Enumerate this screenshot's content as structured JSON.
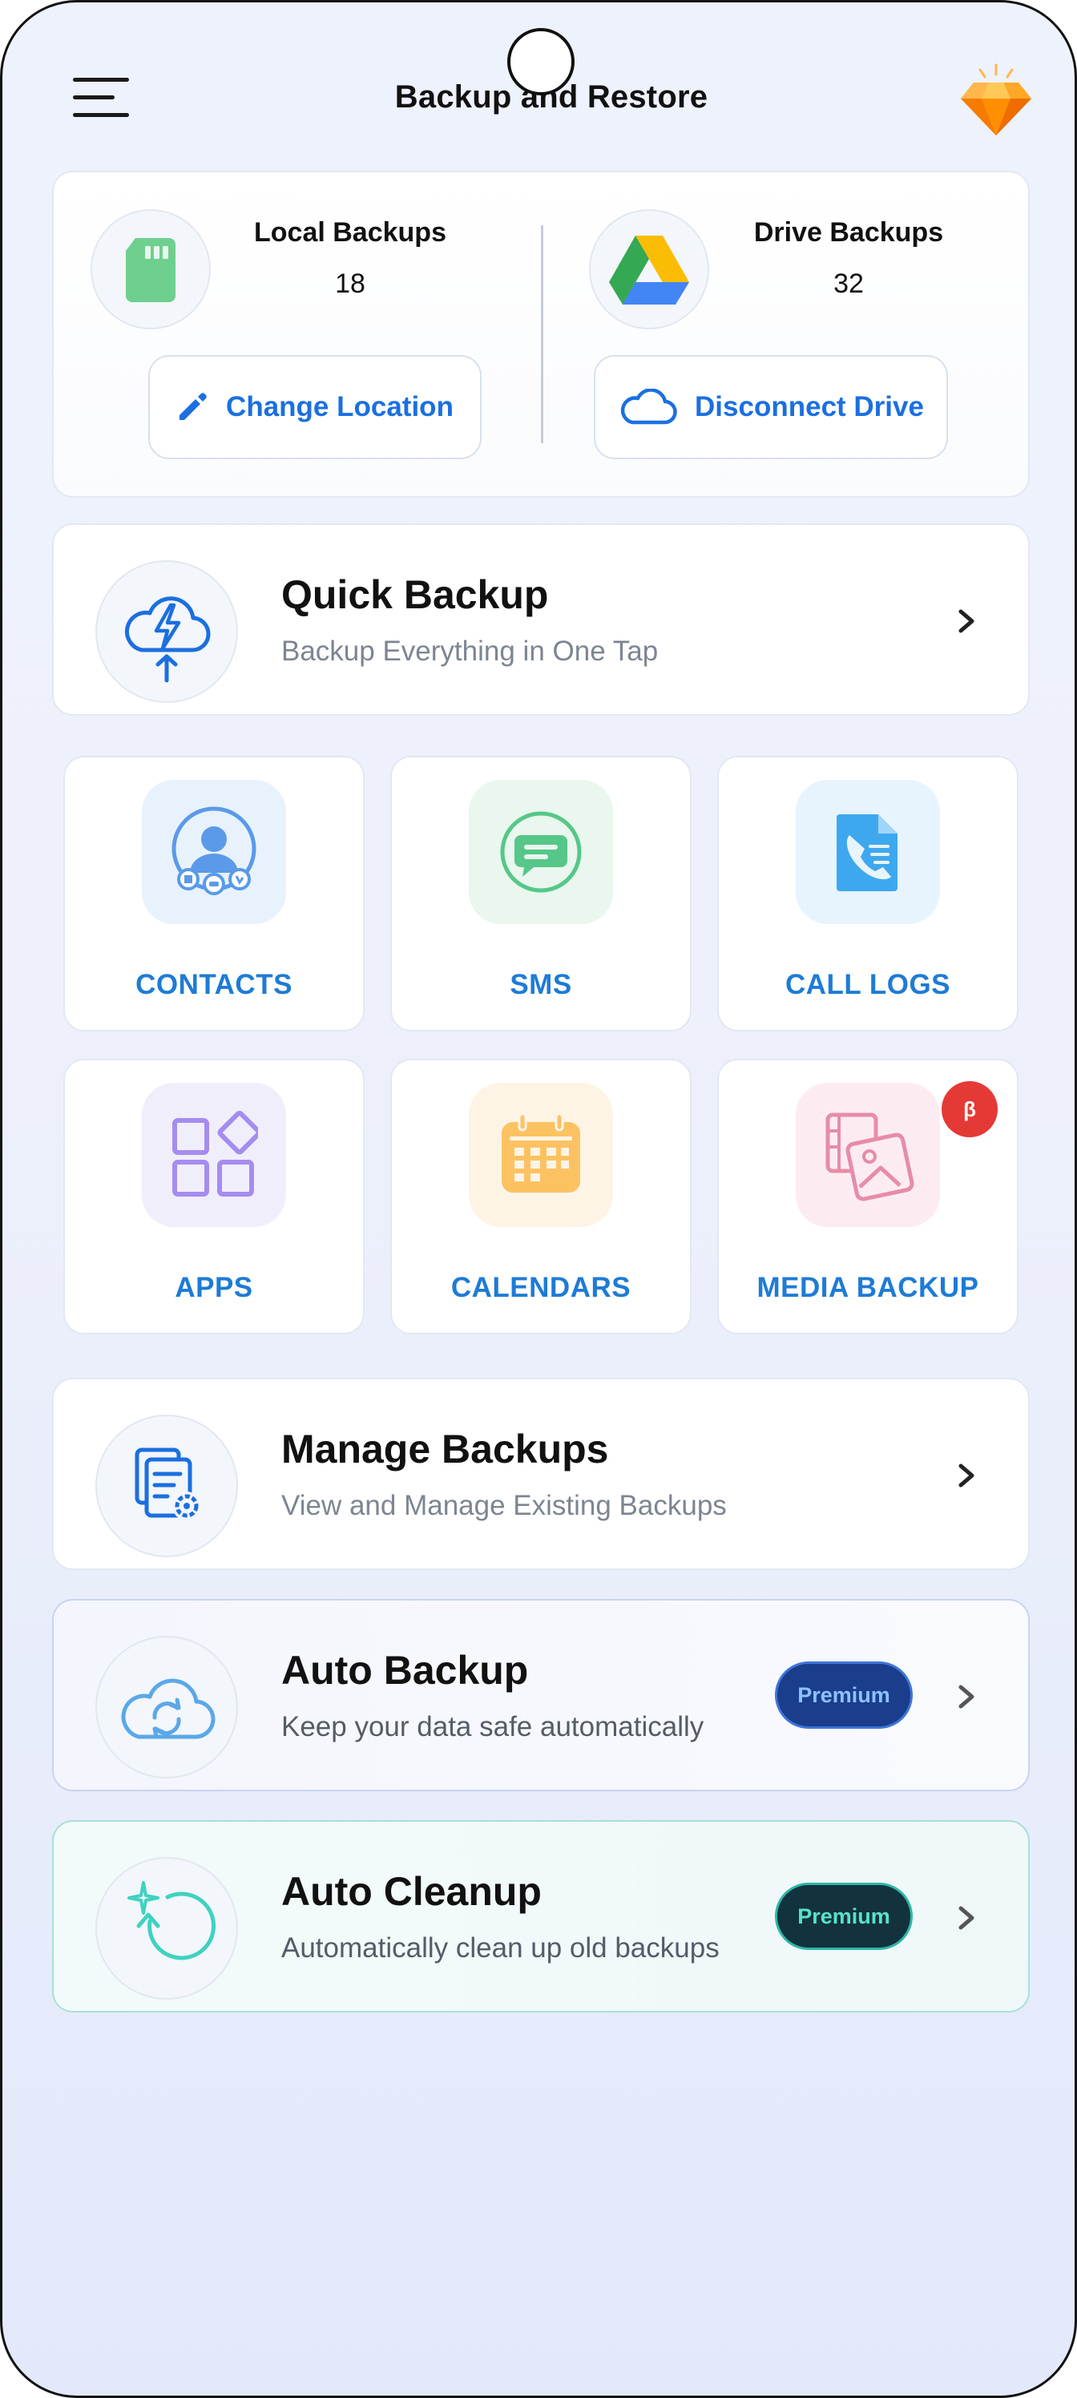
{
  "header": {
    "title": "Backup and Restore",
    "menu_icon": "hamburger-menu-icon",
    "premium_icon": "diamond-gem-icon"
  },
  "summary": {
    "local": {
      "label": "Local Backups",
      "count": "18",
      "icon": "sd-card-icon",
      "button": "Change Location",
      "button_icon": "pencil-icon"
    },
    "drive": {
      "label": "Drive Backups",
      "count": "32",
      "icon": "google-drive-icon",
      "button": "Disconnect Drive",
      "button_icon": "cloud-icon"
    }
  },
  "quick_backup": {
    "title": "Quick Backup",
    "subtitle": "Backup Everything in One Tap",
    "icon": "cloud-lightning-upload-icon"
  },
  "categories": [
    {
      "label": "CONTACTS",
      "icon": "contacts-icon"
    },
    {
      "label": "SMS",
      "icon": "sms-chat-icon"
    },
    {
      "label": "CALL LOGS",
      "icon": "call-logs-icon"
    },
    {
      "label": "APPS",
      "icon": "apps-grid-icon"
    },
    {
      "label": "CALENDARS",
      "icon": "calendar-icon"
    },
    {
      "label": "MEDIA BACKUP",
      "icon": "media-gallery-icon",
      "badge": "β"
    }
  ],
  "manage_backups": {
    "title": "Manage Backups",
    "subtitle": "View and Manage Existing Backups",
    "icon": "documents-gear-icon"
  },
  "auto_backup": {
    "title": "Auto Backup",
    "subtitle": "Keep your data safe automatically",
    "badge": "Premium",
    "icon": "cloud-sync-icon"
  },
  "auto_cleanup": {
    "title": "Auto Cleanup",
    "subtitle": "Automatically clean up old backups",
    "badge": "Premium",
    "icon": "sparkle-refresh-icon"
  },
  "colors": {
    "accent_blue": "#1b6fe0",
    "label_blue": "#1e7bd6",
    "premium_dark_blue": "#1a3e8c",
    "premium_dark_teal": "#12333d",
    "beta_red": "#e53935"
  }
}
